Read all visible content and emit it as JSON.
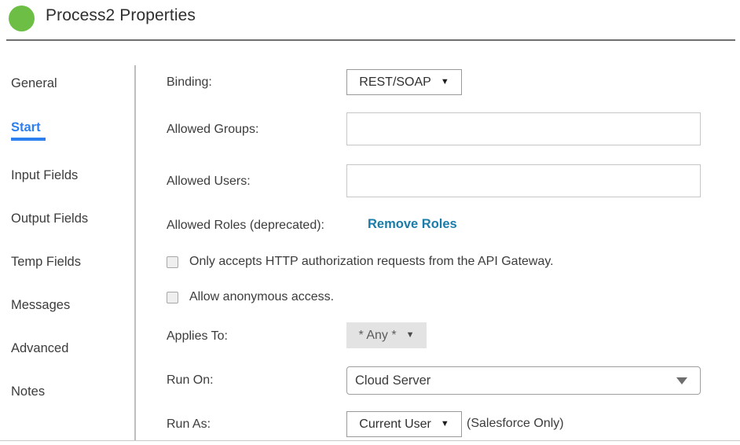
{
  "header": {
    "title": "Process2 Properties",
    "status_color": "#6cbe45",
    "status_icon": "green-circle-icon"
  },
  "sidebar": {
    "items": [
      {
        "label": "General",
        "active": false
      },
      {
        "label": "Start",
        "active": true
      },
      {
        "label": "Input Fields",
        "active": false
      },
      {
        "label": "Output Fields",
        "active": false
      },
      {
        "label": "Temp Fields",
        "active": false
      },
      {
        "label": "Messages",
        "active": false
      },
      {
        "label": "Advanced",
        "active": false
      },
      {
        "label": "Notes",
        "active": false
      }
    ],
    "active_color": "#2d7ff0"
  },
  "form": {
    "binding": {
      "label": "Binding:",
      "value": "REST/SOAP",
      "caret": "▼"
    },
    "allowed_groups": {
      "label": "Allowed Groups:",
      "value": "",
      "placeholder": ""
    },
    "allowed_users": {
      "label": "Allowed Users:",
      "value": "",
      "placeholder": ""
    },
    "allowed_roles": {
      "label": "Allowed Roles (deprecated):",
      "action_label": "Remove Roles",
      "action_color": "#1a7ca8"
    },
    "api_gateway_checkbox": {
      "label": "Only accepts HTTP authorization requests from the API Gateway.",
      "checked": false
    },
    "anonymous_checkbox": {
      "label": "Allow anonymous access.",
      "checked": false
    },
    "applies_to": {
      "label": "Applies To:",
      "value": "* Any *",
      "caret": "▼",
      "disabled": true
    },
    "run_on": {
      "label": "Run On:",
      "value": "Cloud Server"
    },
    "run_as": {
      "label": "Run As:",
      "value": "Current User",
      "caret": "▼",
      "note": "(Salesforce Only)"
    }
  }
}
